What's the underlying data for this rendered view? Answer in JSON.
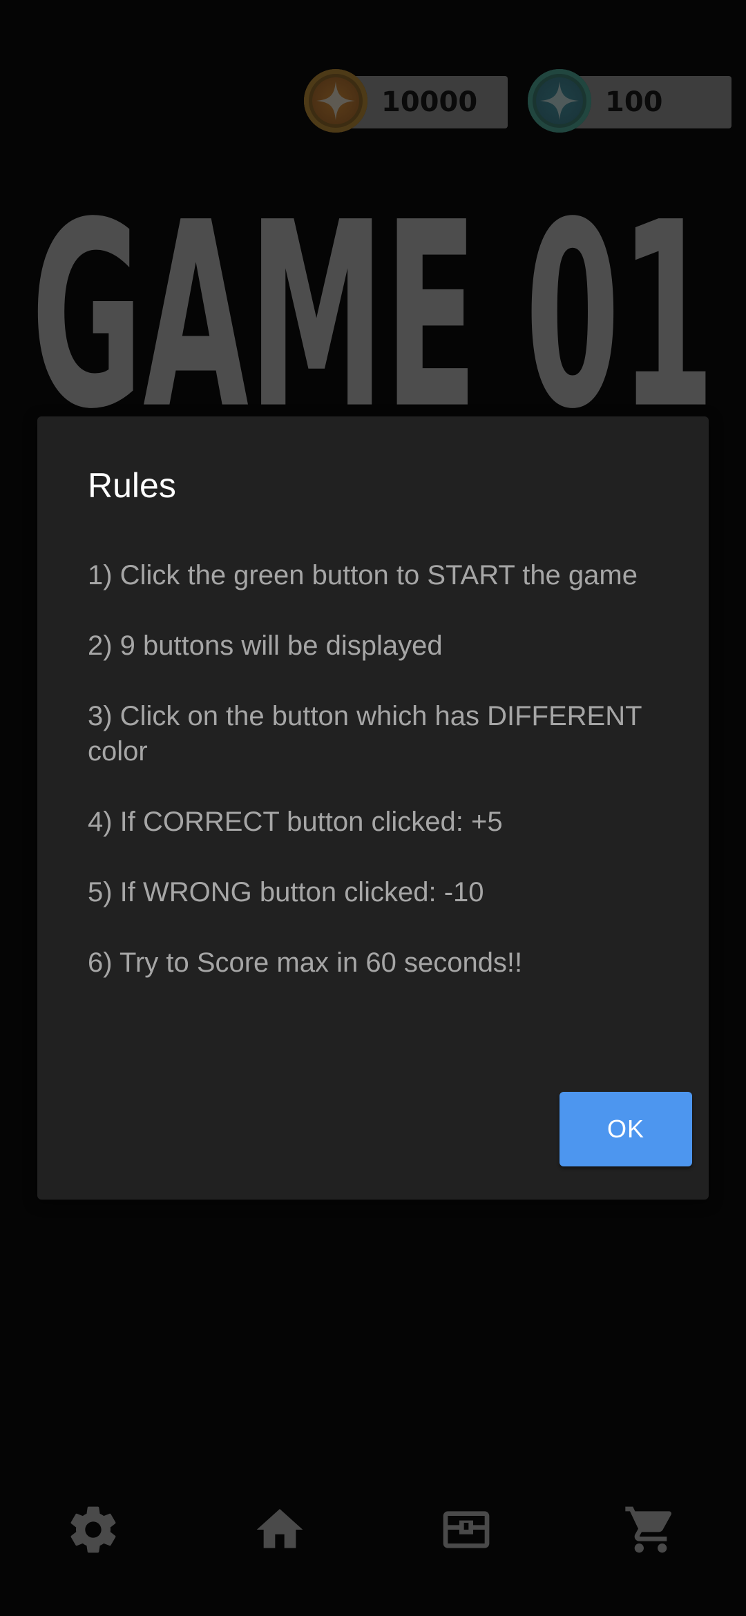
{
  "currency": {
    "gold": {
      "amount": "10000",
      "icon": "sparkle-icon"
    },
    "green": {
      "amount": "100",
      "icon": "sparkle-icon"
    }
  },
  "title": {
    "text": "GAME 01"
  },
  "dialog": {
    "title": "Rules",
    "rules": [
      "1) Click the green button to START the game",
      "2) 9 buttons will be displayed",
      "3) Click on the button which has DIFFERENT color",
      "4) If CORRECT button clicked: +5",
      "5) If WRONG button clicked: -10",
      "6) Try to Score max in 60 seconds!!"
    ],
    "ok_label": "OK"
  },
  "nav": {
    "items": [
      {
        "icon": "gear-icon"
      },
      {
        "icon": "home-icon"
      },
      {
        "icon": "inventory-box-icon"
      },
      {
        "icon": "cart-icon"
      }
    ]
  },
  "colors": {
    "background": "#050505",
    "dialog": "#212121",
    "accent": "#4d96ef",
    "rule_text": "#a6a6a6",
    "title_text": "#4d4d4d",
    "nav_icon": "#4a4a4a"
  }
}
